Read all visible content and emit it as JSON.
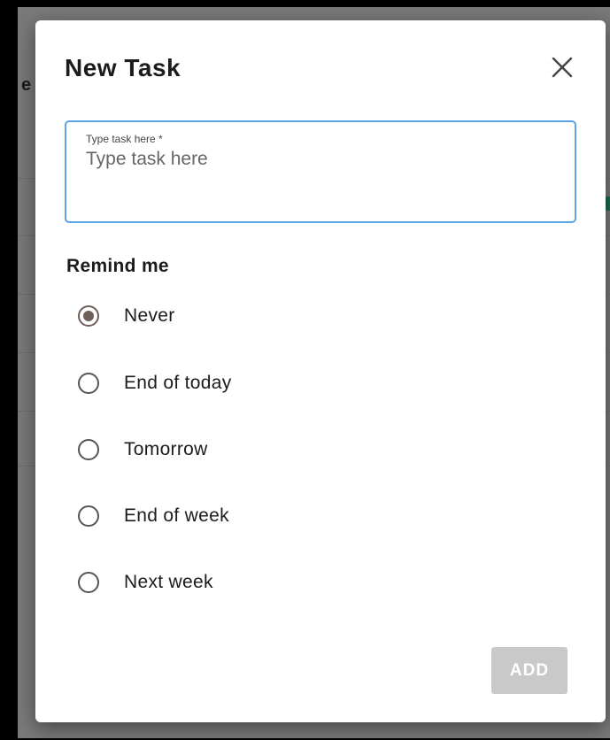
{
  "background": {
    "fragment_text": "e"
  },
  "dialog": {
    "title": "New Task",
    "close_icon": "close-icon",
    "task_field": {
      "label": "Type task here *",
      "placeholder": "Type task here",
      "value": ""
    },
    "remind": {
      "title": "Remind me",
      "selected": "Never",
      "options": [
        {
          "label": "Never",
          "checked": true
        },
        {
          "label": "End of today",
          "checked": false
        },
        {
          "label": "Tomorrow",
          "checked": false
        },
        {
          "label": "End of week",
          "checked": false
        },
        {
          "label": "Next week",
          "checked": false
        }
      ]
    },
    "add_label": "ADD",
    "add_enabled": false
  },
  "colors": {
    "accent_border": "#5aa3e6",
    "radio_checked": "#6e5f58",
    "add_disabled_bg": "#c9c9c9",
    "overlay": "#7a7a7a"
  }
}
